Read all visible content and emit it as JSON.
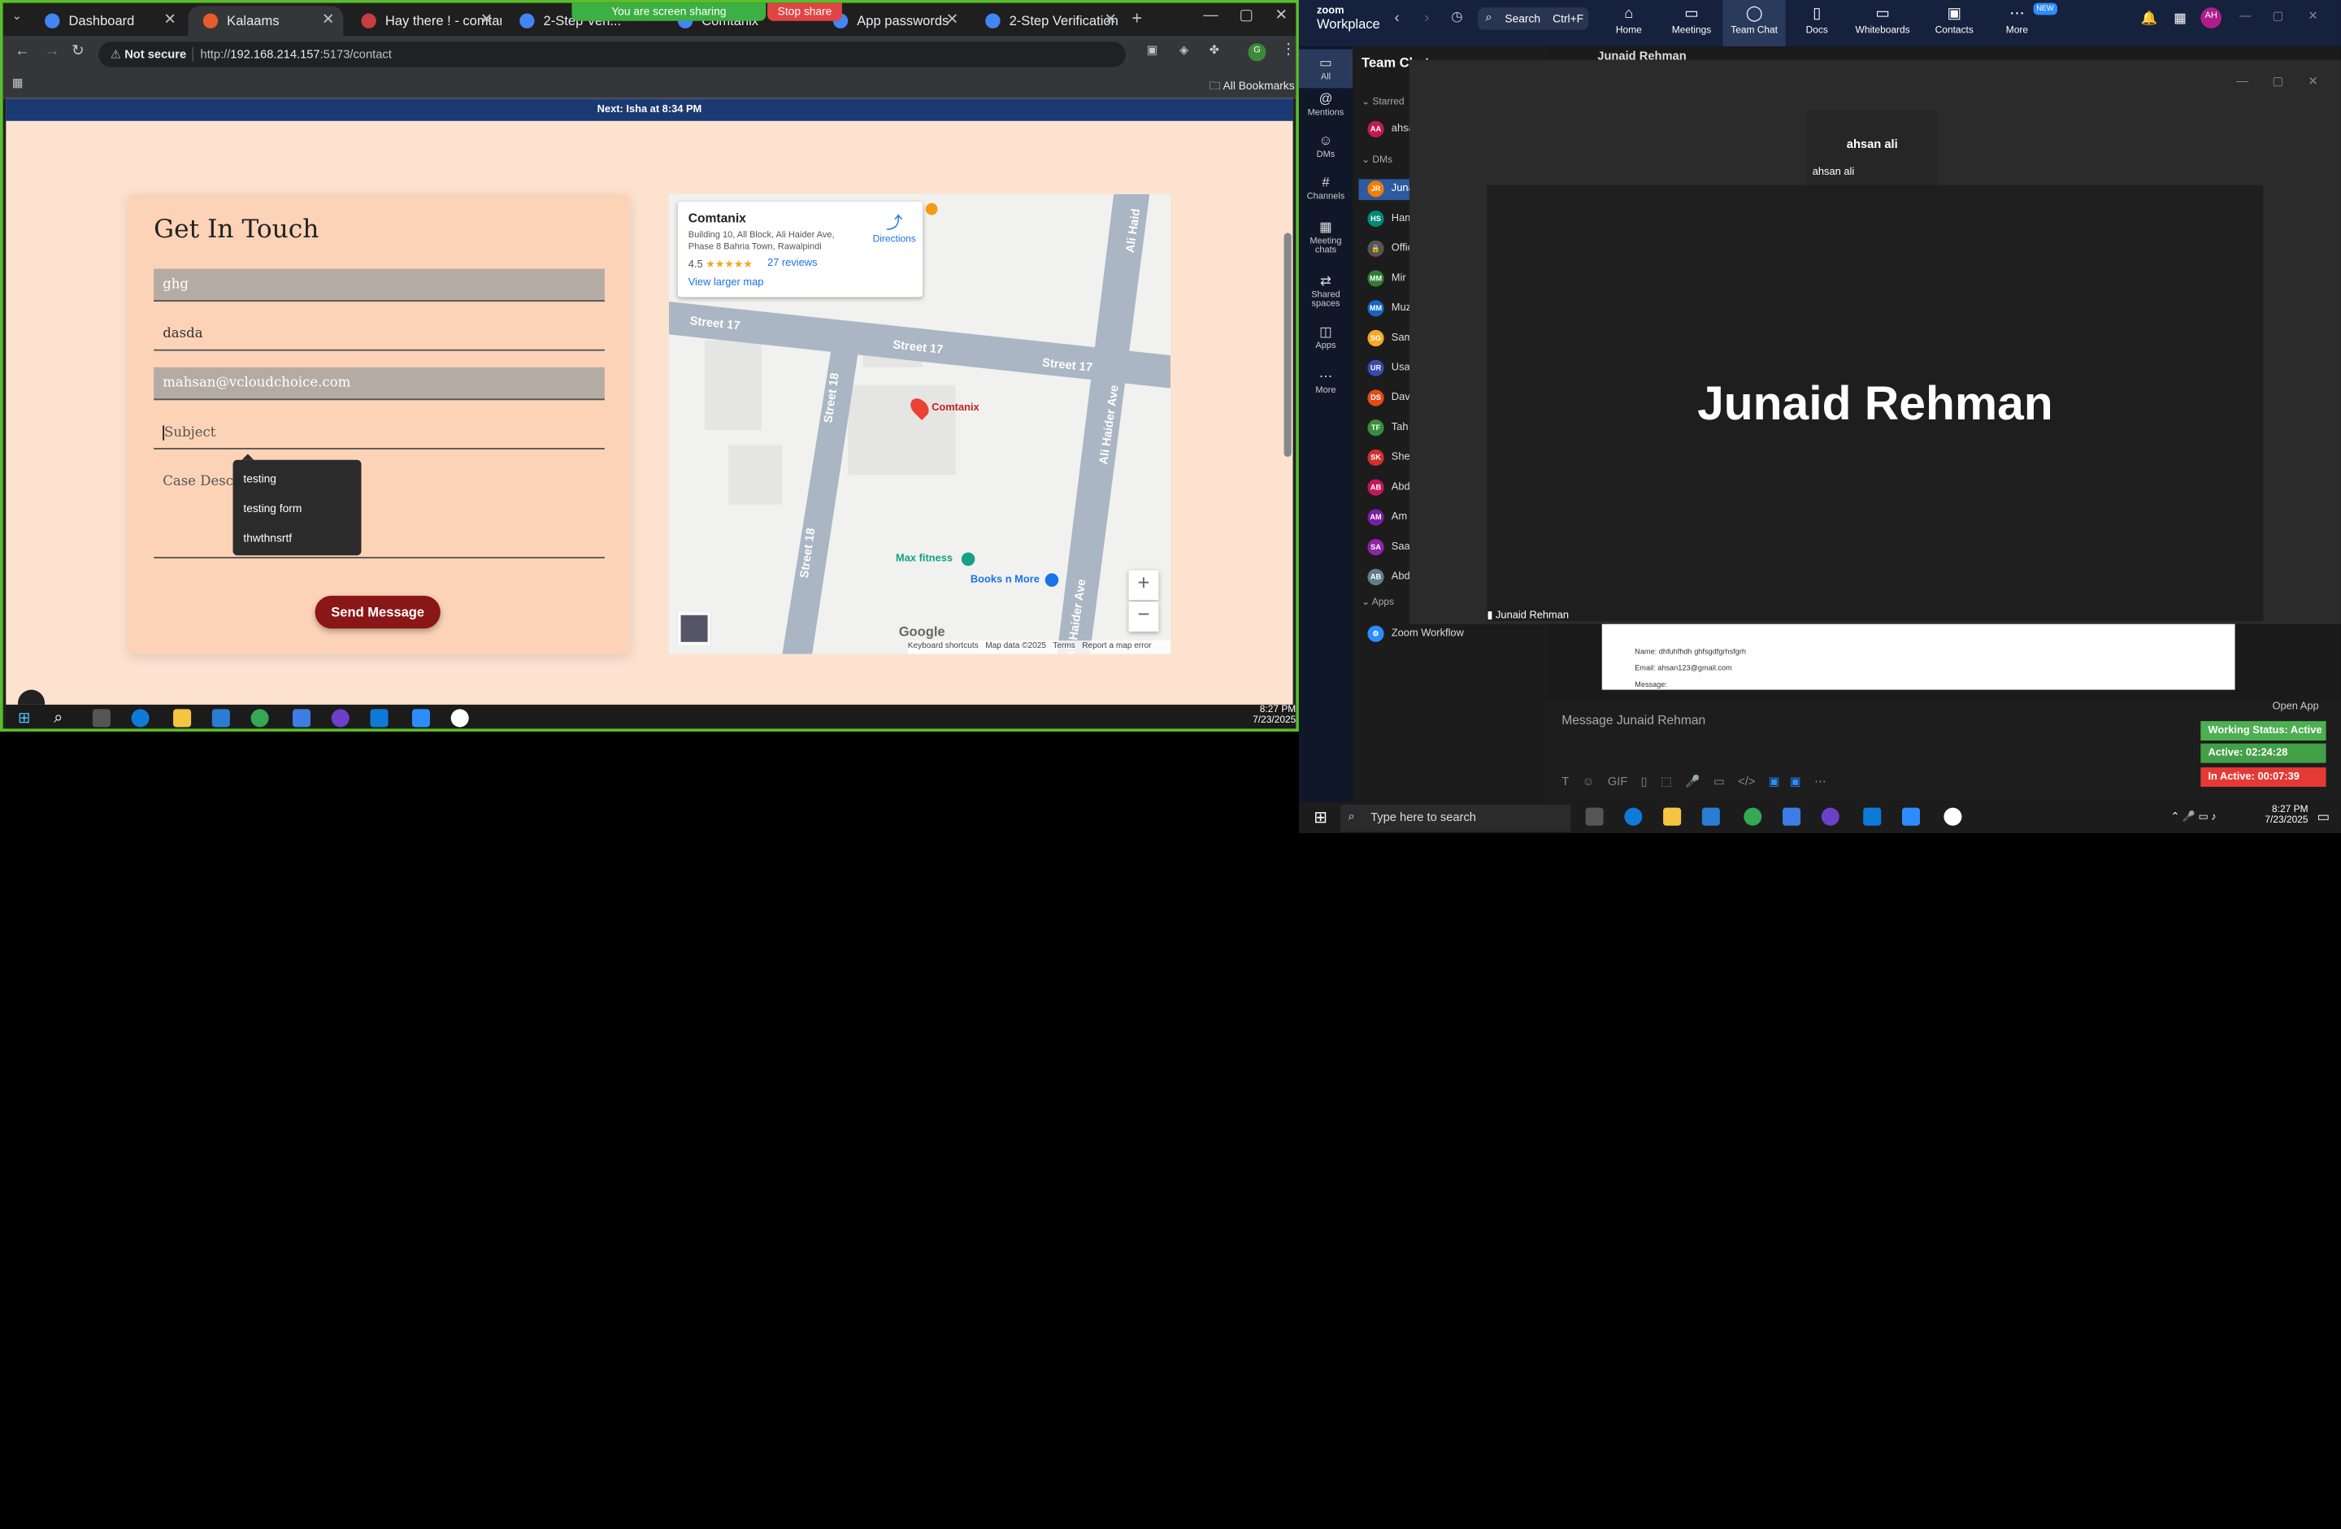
{
  "chrome": {
    "tabs": [
      {
        "label": "Dashboard",
        "color": "#4285f4"
      },
      {
        "label": "Kalaams",
        "color": "#e65c2d"
      },
      {
        "label": "Hay there ! - comtanix",
        "color": "#c73e3e"
      },
      {
        "label": "2-Step Veri...",
        "color": "#4285f4"
      },
      {
        "label": "Comtanix",
        "color": "#4285f4"
      },
      {
        "label": "App passwords",
        "color": "#4285f4"
      },
      {
        "label": "2-Step Verification",
        "color": "#4285f4"
      }
    ],
    "sharing_banner": "You are screen sharing",
    "stop_share": "Stop share",
    "not_secure": "Not secure",
    "url_prefix": "http://",
    "url_host": "192.168.214.157",
    "url_rest": ":5173/contact",
    "all_bookmarks": "All Bookmarks"
  },
  "page": {
    "next_prayer": "Next: Isha at 8:34 PM",
    "form": {
      "title": "Get In Touch",
      "fields": {
        "name": "ghg",
        "phone": "dasda",
        "email": "mahsan@vcloudchoice.com",
        "subject_placeholder": "Subject",
        "description_placeholder": "Case Description"
      },
      "submit": "Send Message",
      "autocomplete": [
        "testing",
        "testing form",
        "thwthnsrtf"
      ]
    },
    "map": {
      "place_name": "Comtanix",
      "address": "Building 10, All Block, Ali Haider Ave, Phase 8 Bahria Town, Rawalpindi",
      "rating": "4.5",
      "stars": "★★★★★",
      "reviews": "27 reviews",
      "directions": "Directions",
      "larger_map": "View larger map",
      "streets": [
        "Street 17",
        "Street 17",
        "Street 17",
        "Street 18",
        "Street 18",
        "Ali Haider Ave",
        "Ali Haider Ave",
        "Ali Haid"
      ],
      "pois": {
        "comtanix": "Comtanix",
        "max_fitness": "Max fitness",
        "books": "Books n More"
      },
      "google": "Google",
      "footer": [
        "Keyboard shortcuts",
        "Map data ©2025",
        "Terms",
        "Report a map error"
      ]
    }
  },
  "taskbar_left": {
    "time": "8:27 PM",
    "date": "7/23/2025"
  },
  "zoom": {
    "brand": "zoom",
    "brand_sub": "Workplace",
    "search": "Search",
    "search_shortcut": "Ctrl+F",
    "nav": [
      "Home",
      "Meetings",
      "Team Chat",
      "Docs",
      "Whiteboards",
      "Contacts",
      "More"
    ],
    "new_badge": "NEW",
    "user_initials": "AH",
    "left_rail": [
      "All",
      "Mentions",
      "DMs",
      "Channels",
      "Meeting chats",
      "Shared spaces",
      "Apps",
      "More"
    ],
    "panel_title": "Team Chat",
    "sections": {
      "starred": "Starred",
      "dms": "DMs",
      "apps": "Apps"
    },
    "channel_items": [
      {
        "initials": "AA",
        "name": "ahsan",
        "color": "#c2185b"
      },
      {
        "initials": "JR",
        "name": "Junaid",
        "color": "#f57c00"
      },
      {
        "initials": "HS",
        "name": "Hamza",
        "color": "#00897b"
      },
      {
        "initials": "",
        "name": "Office",
        "color": "#555555"
      },
      {
        "initials": "MM",
        "name": "Mir",
        "color": "#2e7d32"
      },
      {
        "initials": "MM",
        "name": "Muz",
        "color": "#1565c0"
      },
      {
        "initials": "SG",
        "name": "Sam",
        "color": "#f9a825"
      },
      {
        "initials": "UR",
        "name": "Usa",
        "color": "#3949ab"
      },
      {
        "initials": "DS",
        "name": "Dav",
        "color": "#e64a19"
      },
      {
        "initials": "TF",
        "name": "Tah",
        "color": "#388e3c"
      },
      {
        "initials": "SK",
        "name": "She",
        "color": "#d32f2f"
      },
      {
        "initials": "AB",
        "name": "Abd",
        "color": "#c2185b"
      },
      {
        "initials": "AM",
        "name": "Am",
        "color": "#7b1fa2"
      },
      {
        "initials": "SA",
        "name": "Saa",
        "color": "#8e24aa"
      },
      {
        "initials": "AB",
        "name": "Abd",
        "color": "#607d8b"
      }
    ],
    "zoom_workflow": "Zoom Workflow",
    "chat_header": "Junaid Rehman",
    "meeting": {
      "thumb_name_big": "ahsan ali",
      "thumb_name_small": "ahsan ali",
      "speaker": "Junaid Rehman",
      "speaker_label": "Junaid Rehman"
    },
    "email_preview": {
      "name": "Name: dhfuhfhdh ghfsgdfgrhsfgrh",
      "email": "Email: ahsan123@gmail.com",
      "message": "Message:"
    },
    "composer_placeholder": "Message Junaid Rehman",
    "open_app": "Open App",
    "status": [
      {
        "label": "Working Status: Active",
        "color": "#4caf50"
      },
      {
        "label": "Active: 02:24:28",
        "color": "#43a047"
      },
      {
        "label": "In Active: 00:07:39",
        "color": "#e53935"
      }
    ]
  },
  "taskbar_right": {
    "search": "Type here to search",
    "time": "8:27 PM",
    "date": "7/23/2025"
  }
}
